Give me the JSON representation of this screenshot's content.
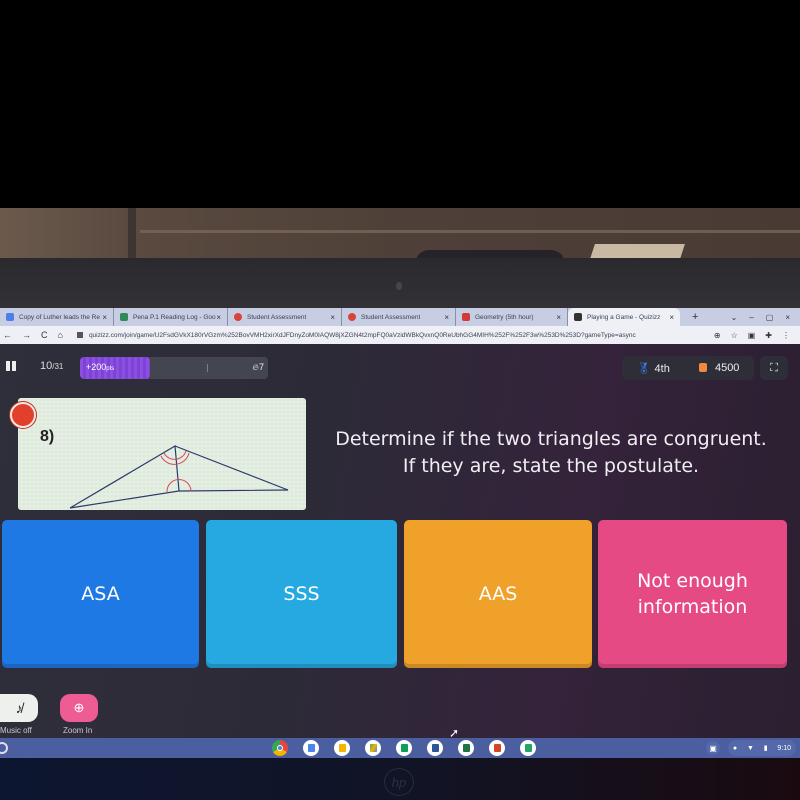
{
  "browser": {
    "tabs": [
      {
        "label": "Copy of Luther leads the Re",
        "favicon_color": "#4a7ee8",
        "active": false
      },
      {
        "label": "Pena P.1 Reading Log - Goo",
        "favicon_color": "#2e8b57",
        "active": false
      },
      {
        "label": "Student Assessment",
        "favicon_color": "#d9443a",
        "active": false
      },
      {
        "label": "Student Assessment",
        "favicon_color": "#d9443a",
        "active": false
      },
      {
        "label": "Geometry (5th hour)",
        "favicon_color": "#d33a3a",
        "active": false
      },
      {
        "label": "Playing a Game - Quizizz",
        "favicon_color": "#333333",
        "active": true
      }
    ],
    "close_glyph": "×",
    "new_tab_glyph": "+",
    "window_controls": [
      "⌄",
      "–",
      "▢",
      "×"
    ],
    "nav": {
      "back": "←",
      "forward": "→",
      "reload": "C",
      "home": "⌂"
    },
    "url": "quizizz.com/join/game/U2FsdGVkX180rVGzm%252BovVMH2xirXdJFDnyZoM0IAQW8jXZGN4t2mpFQ0aVzidWBkQvxnQ0ReUbhGG4MIH%252F%252F3w%253D%253D?gameType=async",
    "toolbar_icons": [
      "zoom-icon",
      "star-icon",
      "cast-icon",
      "extensions-icon",
      "menu-icon"
    ]
  },
  "quiz": {
    "question_counter": {
      "current": "10",
      "total": "/31"
    },
    "progress_fraction": 0.37,
    "points_label": "+200",
    "points_unit": "pts",
    "streak": "7",
    "rank": "4th",
    "score": "4500",
    "question_number": "8)",
    "question_text": "Determine if the two triangles are congruent. If they are, state the postulate.",
    "question_text_line1": "Determine if the two triangles are congruent.",
    "question_text_line2": "If they are, state the postulate.",
    "options": [
      {
        "label": "ASA",
        "color": "#1f79e4"
      },
      {
        "label": "SSS",
        "color": "#26a9e0"
      },
      {
        "label": "AAS",
        "color": "#efa12a"
      },
      {
        "label": "Not enough information",
        "color": "#e54a85"
      }
    ],
    "controls": {
      "music_label": "Music off",
      "zoom_label": "Zoom In"
    }
  },
  "shelf": {
    "apps": [
      {
        "name": "chrome",
        "color": "#e8453c"
      },
      {
        "name": "docs",
        "color": "#4a86e8"
      },
      {
        "name": "slides",
        "color": "#f4b400"
      },
      {
        "name": "drive",
        "color": "#34a853"
      },
      {
        "name": "sheets",
        "color": "#0f9d58"
      },
      {
        "name": "word",
        "color": "#2b579a"
      },
      {
        "name": "excel",
        "color": "#217346"
      },
      {
        "name": "powerpoint",
        "color": "#d24726"
      },
      {
        "name": "classroom",
        "color": "#25a667"
      }
    ],
    "time": "9:10"
  },
  "device": {
    "brand": "hp"
  }
}
